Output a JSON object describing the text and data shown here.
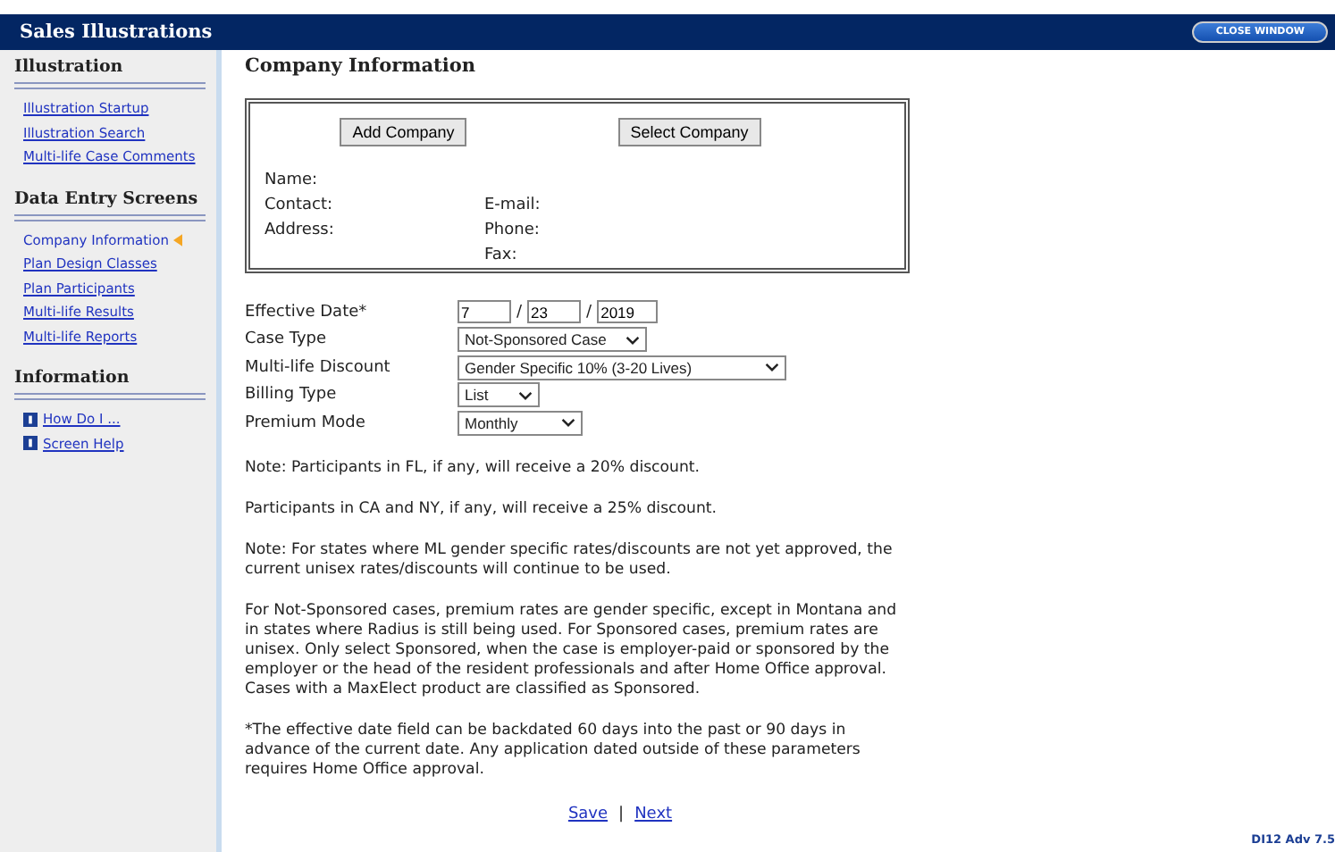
{
  "header": {
    "title": "Sales Illustrations",
    "close_button": "CLOSE WINDOW"
  },
  "sidebar": [
    {
      "heading": "Illustration",
      "items": [
        {
          "label": "Illustration Startup",
          "selected": false
        },
        {
          "label": "Illustration Search",
          "selected": false
        },
        {
          "label": "Multi-life Case Comments",
          "selected": false
        }
      ]
    },
    {
      "heading": "Data Entry Screens",
      "items": [
        {
          "label": "Company Information",
          "selected": true
        },
        {
          "label": "Plan Design Classes",
          "selected": false
        },
        {
          "label": "Plan Participants",
          "selected": false
        },
        {
          "label": "Multi-life Results",
          "selected": false
        },
        {
          "label": "Multi-life Reports",
          "selected": false
        }
      ]
    },
    {
      "heading": "Information",
      "kind": "info",
      "items": [
        {
          "label": "How Do I ...",
          "selected": false
        },
        {
          "label": "Screen Help",
          "selected": false
        }
      ]
    }
  ],
  "page_title": "Company Information",
  "company": {
    "buttons": [
      "Add Company",
      "Select Company"
    ],
    "left_labels": [
      "Name:",
      "Contact:",
      "Address:"
    ],
    "right_labels": [
      "E-mail:",
      "Phone:",
      "Fax:"
    ]
  },
  "fields": [
    {
      "label": "Effective Date*",
      "kind": "date",
      "values": [
        "7",
        "23",
        "2019"
      ],
      "separator": "/"
    },
    {
      "label": "Case Type",
      "kind": "select",
      "value": "Not-Sponsored Case"
    },
    {
      "label": "Multi-life Discount",
      "kind": "select",
      "value": "Gender Specific 10% (3-20 Lives)"
    },
    {
      "label": "Billing Type",
      "kind": "select",
      "value": "List"
    },
    {
      "label": "Premium Mode",
      "kind": "select",
      "value": "Monthly"
    }
  ],
  "notes": [
    "Note: Participants in FL, if any, will receive a 20% discount.",
    "Participants in CA and NY, if any, will receive a 25% discount.",
    "Note: For states where ML gender specific rates/discounts are not yet approved, the current unisex rates/discounts will continue to be used.",
    "For Not-Sponsored cases, premium rates are gender specific, except in Montana and in states where Radius is still being used. For Sponsored cases, premium rates are unisex. Only select Sponsored, when the case is employer-paid or sponsored by the employer or the head of the resident professionals and after Home Office approval. Cases with a MaxElect product are classified as Sponsored.",
    "*The effective date field can be backdated 60 days into the past or 90 days in advance of the current date. Any application dated outside of these parameters requires Home Office approval."
  ],
  "footer_links": [
    "Save",
    "Next"
  ],
  "separator": "|",
  "version": "DI12 Adv 7.5"
}
